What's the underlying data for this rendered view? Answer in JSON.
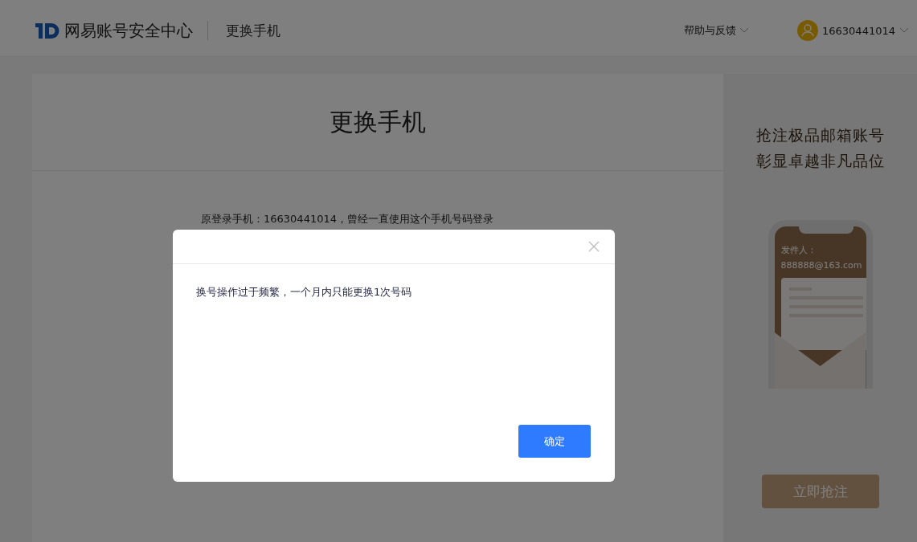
{
  "header": {
    "logo_text": "网易账号安全中心",
    "page_title": "更换手机",
    "help": "帮助与反馈",
    "account": "16630441014"
  },
  "card": {
    "title": "更换手机",
    "line": "原登录手机：16630441014，曾经一直使用这个手机号码登录"
  },
  "ad": {
    "headline": [
      "抢注极品邮箱账号",
      "彰显卓越非凡品位"
    ],
    "sender_label": "发件人：",
    "sender": "888888@163.com",
    "button": "立即抢注"
  },
  "dialog": {
    "message": "换号操作过于频繁，一个月内只能更换1次号码",
    "confirm": "确定"
  }
}
